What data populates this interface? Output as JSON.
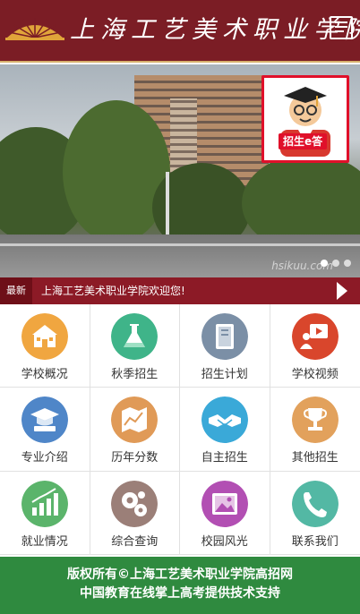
{
  "header": {
    "title": "上海工艺美术职业学院",
    "menu_icon": "menu-list-icon"
  },
  "banner": {
    "promo_label": "招生e答",
    "watermark": "hsikuu.com",
    "slide_count": 3,
    "active_slide": 1
  },
  "ticker": {
    "badge": "最新",
    "text": "上海工艺美术职业学院欢迎您!"
  },
  "menu": [
    {
      "label": "学校概况",
      "icon": "school-building-icon",
      "color": "#f0a640"
    },
    {
      "label": "秋季招生",
      "icon": "flask-icon",
      "color": "#3fb489"
    },
    {
      "label": "招生计划",
      "icon": "book-icon",
      "color": "#7b8fa6"
    },
    {
      "label": "学校视频",
      "icon": "video-presenter-icon",
      "color": "#d9462c"
    },
    {
      "label": "专业介绍",
      "icon": "graduation-cap-icon",
      "color": "#4f86c8"
    },
    {
      "label": "历年分数",
      "icon": "map-chart-icon",
      "color": "#e09a57"
    },
    {
      "label": "自主招生",
      "icon": "handshake-icon",
      "color": "#3aa9d8"
    },
    {
      "label": "其他招生",
      "icon": "trophy-icon",
      "color": "#e2a15c"
    },
    {
      "label": "就业情况",
      "icon": "growth-chart-icon",
      "color": "#5bb46b"
    },
    {
      "label": "综合查询",
      "icon": "gears-icon",
      "color": "#9b7f78"
    },
    {
      "label": "校园风光",
      "icon": "picture-frame-icon",
      "color": "#b24fb3"
    },
    {
      "label": "联系我们",
      "icon": "phone-icon",
      "color": "#53b8a4"
    }
  ],
  "footer": {
    "line1": "版权所有©上海工艺美术职业学院高招网",
    "line2": "中国教育在线掌上高考提供技术支持"
  },
  "colors": {
    "header_bg": "#7b1d25",
    "ticker_bg": "#8c1a26",
    "footer_bg": "#2f8a3f"
  }
}
